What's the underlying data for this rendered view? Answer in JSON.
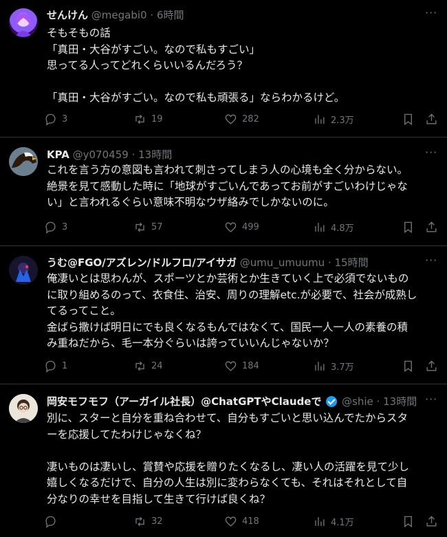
{
  "tweets": [
    {
      "name": "せんけん",
      "handle": "@megabi0",
      "time": "6時間",
      "text": "そもそもの話\n「真田・大谷がすごい。なので私もすごい」\n思ってる人ってどれくらいいるんだろう？\n\n「真田・大谷がすごい。なので私も頑張る」ならわかるけど。",
      "replies": "3",
      "retweets": "19",
      "likes": "282",
      "views": "2.3万"
    },
    {
      "name": "KPA",
      "handle": "@y070459",
      "time": "13時間",
      "text": "これを言う方の意図も言われて刺さってしまう人の心境も全く分からない。\n絶景を見て感動した時に「地球がすごいんであってお前がすごいわけじゃな\nい」と言われるぐらい意味不明なウザ絡みでしかないのに。",
      "replies": "3",
      "retweets": "57",
      "likes": "499",
      "views": "4.8万"
    },
    {
      "name": "うむ@FGO/アズレン/ドルフロ/アイサガ",
      "handle": "@umu_umuumu",
      "time": "15時間",
      "text": "俺凄いとは思わんが、スポーツとか芸術とか生きていく上で必須でないもの\nに取り組めるのって、衣食住、治安、周りの理解etc.が必要で、社会が成熟し\nてるってこと。\n金ばら撒けば明日にでも良くなるもんではなくて、国民一人一人の素養の積\nみ重ねだから、毛一本分ぐらいは誇っていいんじゃないか？",
      "replies": "1",
      "retweets": "24",
      "likes": "184",
      "views": "3.7万"
    },
    {
      "name": "岡安モフモフ（アーガイル社長）@ChatGPTやClaudeで",
      "handle": "@shie",
      "time": "13時間",
      "text": "別に、スターと自分を重ね合わせて、自分もすごいと思い込んでたからスタ\nーを応援してたわけじゃなくね？\n\n凄いものは凄いし、賞賛や応援を贈りたくなるし、凄い人の活躍を見て少し\n嬉しくなるだけで、自分の人生は別に変わらなくても、それはそれとして自\n分なりの幸せを目指して生きて行けば良くね？",
      "replies": "",
      "retweets": "32",
      "likes": "418",
      "views": "4.1万"
    }
  ],
  "colors": {
    "background": "#000000",
    "text": "#e7e9ea",
    "muted": "#71767b",
    "divider": "#2f3336",
    "verified": "#1d9bf0"
  },
  "icons": [
    "reply-icon",
    "retweet-icon",
    "like-icon",
    "views-icon",
    "bookmark-icon",
    "share-icon",
    "more-icon",
    "verified-icon"
  ]
}
